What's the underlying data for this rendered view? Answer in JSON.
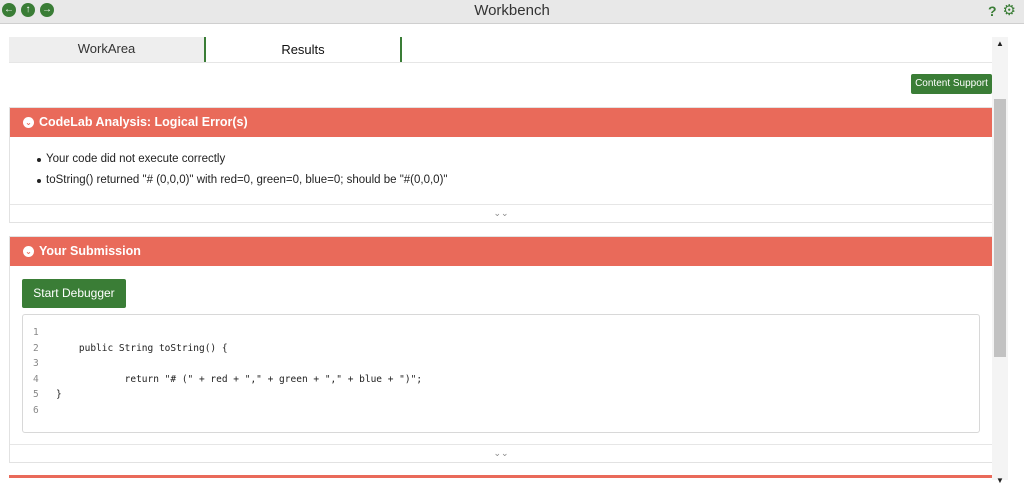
{
  "window": {
    "title": "Workbench",
    "help_label": "?",
    "nav_icons": [
      "back-icon",
      "up-icon",
      "forward-icon"
    ],
    "right_icons": [
      "help-icon",
      "gear-icon"
    ]
  },
  "tabs": [
    {
      "label": "WorkArea"
    },
    {
      "label": "Results"
    }
  ],
  "content_support_label": "Content Support",
  "analysis": {
    "title": "CodeLab Analysis: Logical Error(s)",
    "errors": [
      "Your code did not execute correctly",
      "toString() returned \"# (0,0,0)\" with red=0, green=0, blue=0; should be \"#(0,0,0)\""
    ]
  },
  "submission": {
    "title": "Your Submission",
    "debug_label": "Start Debugger",
    "code_lines": [
      {
        "no": "1",
        "text": ""
      },
      {
        "no": "2",
        "text": "    public String toString() {"
      },
      {
        "no": "3",
        "text": ""
      },
      {
        "no": "4",
        "text": "            return \"# (\" + red + \",\" + green + \",\" + blue + \")\";"
      },
      {
        "no": "5",
        "text": "}"
      },
      {
        "no": "6",
        "text": ""
      }
    ]
  },
  "colors": {
    "accent_green": "#3a7d36",
    "error_red": "#e96a5a"
  }
}
